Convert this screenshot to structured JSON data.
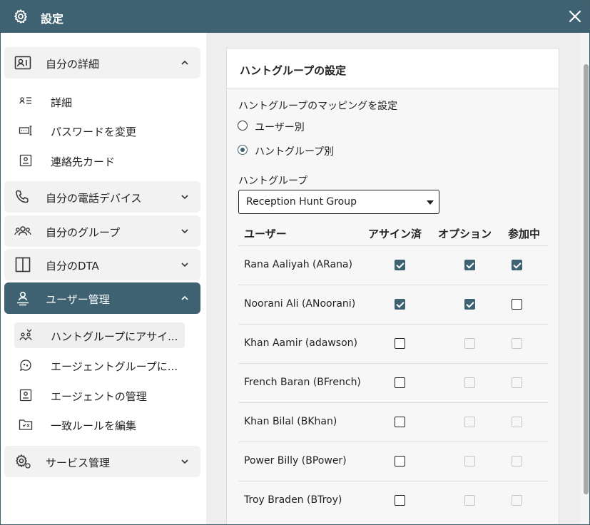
{
  "window": {
    "title": "設定",
    "accent": "#3f6272"
  },
  "sidebar": {
    "sections": [
      {
        "label": "自分の詳細",
        "expanded": true,
        "icon": "contact-card-icon"
      },
      {
        "label": "自分の電話デバイス",
        "expanded": false,
        "icon": "phone-icon"
      },
      {
        "label": "自分のグループ",
        "expanded": false,
        "icon": "group-icon"
      },
      {
        "label": "自分のDTA",
        "expanded": false,
        "icon": "dta-panel-icon"
      },
      {
        "label": "ユーザー管理",
        "expanded": true,
        "active": true,
        "icon": "user-admin-icon"
      },
      {
        "label": "サービス管理",
        "expanded": false,
        "icon": "service-gear-icon"
      }
    ],
    "details_items": [
      {
        "label": "詳細",
        "icon": "details-list-icon"
      },
      {
        "label": "パスワードを変更",
        "icon": "password-icon"
      },
      {
        "label": "連絡先カード",
        "icon": "contact-card-icon"
      }
    ],
    "user_admin_items": [
      {
        "label": "ハントグループにアサイ...",
        "icon": "hunt-group-assign-icon",
        "selected": true
      },
      {
        "label": "エージェントグループに...",
        "icon": "agent-group-icon"
      },
      {
        "label": "エージェントの管理",
        "icon": "agent-manage-icon"
      },
      {
        "label": "一致ルールを編集",
        "icon": "match-rule-icon"
      }
    ]
  },
  "main": {
    "card_title": "ハントグループの設定",
    "mapping_label": "ハントグループのマッピングを設定",
    "radio_options": [
      {
        "label": "ユーザー別",
        "selected": false
      },
      {
        "label": "ハントグループ別",
        "selected": true
      }
    ],
    "hunt_group_label": "ハントグループ",
    "hunt_group_value": "Reception Hunt Group",
    "table": {
      "headers": [
        "ユーザー",
        "アサイン済",
        "オプション",
        "参加中"
      ],
      "rows": [
        {
          "user": "Rana Aaliyah (ARana)",
          "assigned": true,
          "optional": true,
          "optional_enabled": true,
          "joined": true,
          "joined_enabled": true
        },
        {
          "user": "Noorani Ali (ANoorani)",
          "assigned": true,
          "optional": true,
          "optional_enabled": true,
          "joined": false,
          "joined_enabled": true
        },
        {
          "user": "Khan Aamir (adawson)",
          "assigned": false,
          "optional": false,
          "optional_enabled": false,
          "joined": false,
          "joined_enabled": false
        },
        {
          "user": "French Baran (BFrench)",
          "assigned": false,
          "optional": false,
          "optional_enabled": false,
          "joined": false,
          "joined_enabled": false
        },
        {
          "user": "Khan Bilal (BKhan)",
          "assigned": false,
          "optional": false,
          "optional_enabled": false,
          "joined": false,
          "joined_enabled": false
        },
        {
          "user": "Power Billy (BPower)",
          "assigned": false,
          "optional": false,
          "optional_enabled": false,
          "joined": false,
          "joined_enabled": false
        },
        {
          "user": "Troy Braden (BTroy)",
          "assigned": false,
          "optional": false,
          "optional_enabled": false,
          "joined": false,
          "joined_enabled": false
        }
      ]
    }
  }
}
